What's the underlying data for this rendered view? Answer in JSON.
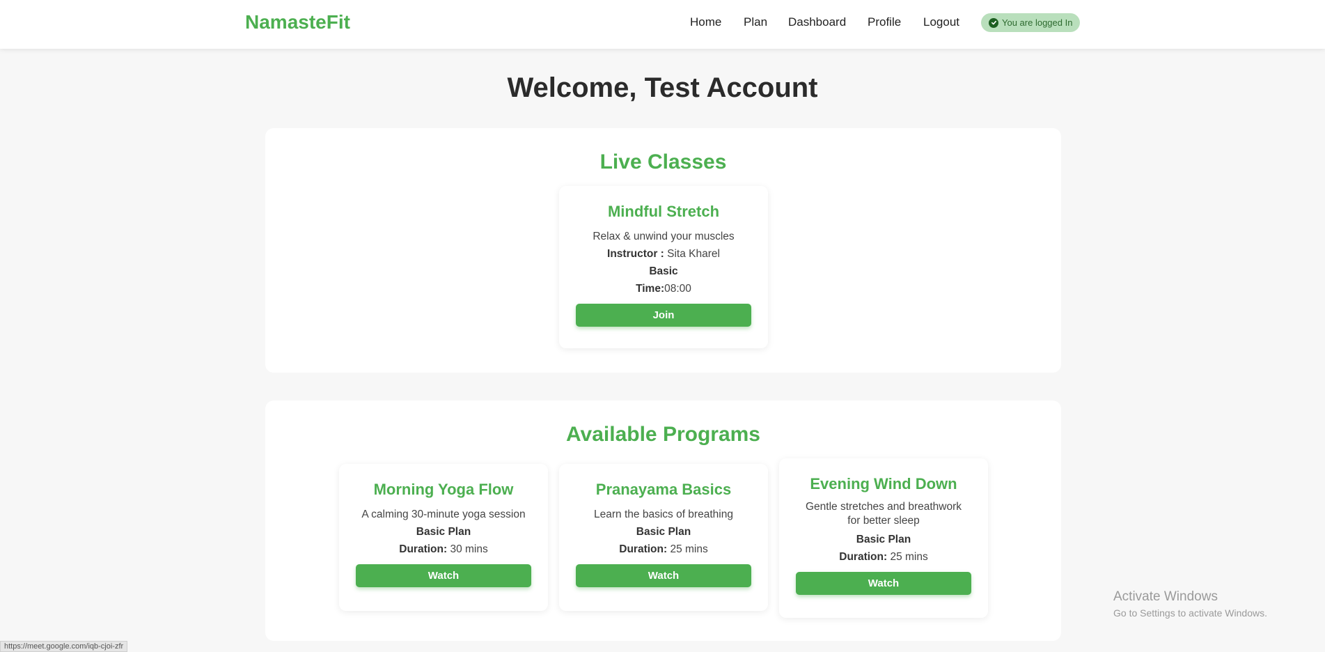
{
  "nav": {
    "brand": "NamasteFit",
    "links": [
      "Home",
      "Plan",
      "Dashboard",
      "Profile",
      "Logout"
    ],
    "status_badge": "You are logged In"
  },
  "page_title": "Welcome, Test Account",
  "live_classes": {
    "heading": "Live Classes",
    "classes": [
      {
        "title": "Mindful Stretch",
        "description": "Relax & unwind your muscles",
        "instructor_label": "Instructor :",
        "instructor": "Sita Kharel",
        "level": "Basic",
        "time_label": "Time:",
        "time": "08:00",
        "button": "Join"
      }
    ]
  },
  "programs": {
    "heading": "Available Programs",
    "items": [
      {
        "title": "Morning Yoga Flow",
        "description": "A calming 30-minute yoga session",
        "plan": "Basic Plan",
        "duration_label": "Duration:",
        "duration": "30 mins",
        "button": "Watch"
      },
      {
        "title": "Pranayama Basics",
        "description": "Learn the basics of breathing",
        "plan": "Basic Plan",
        "duration_label": "Duration:",
        "duration": "25 mins",
        "button": "Watch"
      },
      {
        "title": "Evening Wind Down",
        "description": "Gentle stretches and breathwork for better sleep",
        "plan": "Basic Plan",
        "duration_label": "Duration:",
        "duration": "25 mins",
        "button": "Watch"
      }
    ]
  },
  "os_watermark": {
    "line1": "Activate Windows",
    "line2": "Go to Settings to activate Windows."
  },
  "status_bar_url": "https://meet.google.com/iqb-cjoi-zfr",
  "colors": {
    "accent": "#4caf50",
    "background": "#f7f7f7",
    "badge_bg": "#b9dfbc"
  }
}
